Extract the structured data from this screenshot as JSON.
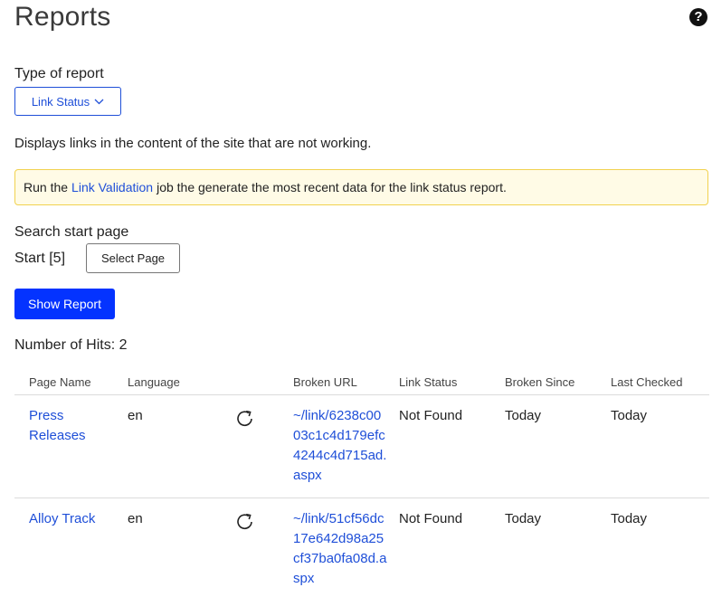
{
  "header": {
    "title": "Reports",
    "help_icon": "?"
  },
  "report_type": {
    "label": "Type of report",
    "selected": "Link Status",
    "description": "Displays links in the content of the site that are not working."
  },
  "alert": {
    "prefix": "Run the",
    "link": "Link Validation",
    "suffix": "job the generate the most recent data for the link status report.",
    "accent_color": "#f1d24f"
  },
  "search": {
    "label": "Search start page",
    "start_value": "Start [5]",
    "select_button": "Select Page"
  },
  "show_report_button": "Show Report",
  "hits": "Number of Hits: 2",
  "table": {
    "columns": [
      "Page Name",
      "Language",
      "Broken URL",
      "Link Status",
      "Broken Since",
      "Last Checked"
    ],
    "rows": [
      {
        "page_name": "Press Releases",
        "language": "en",
        "broken_url": "~/link/6238c0003c1c4d179efc4244c4d715ad.aspx",
        "link_status": "Not Found",
        "broken_since": "Today",
        "last_checked": "Today"
      },
      {
        "page_name": "Alloy Track",
        "language": "en",
        "broken_url": "~/link/51cf56dc17e642d98a25cf37ba0fa08d.aspx",
        "link_status": "Not Found",
        "broken_since": "Today",
        "last_checked": "Today"
      }
    ]
  },
  "colors": {
    "primary": "#0433ff",
    "link": "#1f4fd8"
  }
}
